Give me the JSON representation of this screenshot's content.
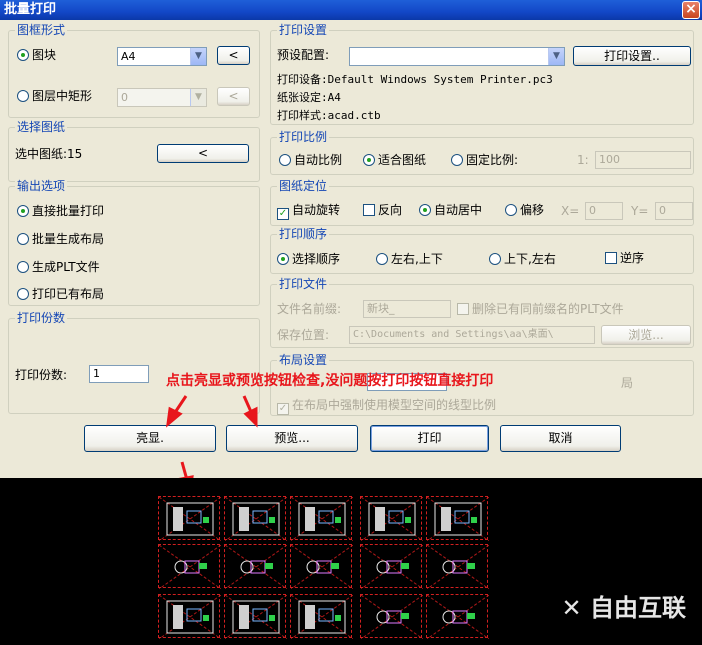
{
  "window": {
    "title": "批量打印",
    "close_glyph": "×"
  },
  "frame_form": {
    "title": "图框形式",
    "block_label": "图块",
    "block_value": "A4",
    "layer_rect_label": "图层中矩形",
    "layer_value": "0",
    "pick_glyph": "<"
  },
  "select_drawing": {
    "title": "选择图纸",
    "selected_label": "选中图纸:15",
    "pick_glyph": "<"
  },
  "output_options": {
    "title": "输出选项",
    "items": [
      "直接批量打印",
      "批量生成布局",
      "生成PLT文件",
      "打印已有布局"
    ],
    "selected": 0
  },
  "copies": {
    "title": "打印份数",
    "label": "打印份数:",
    "value": "1"
  },
  "print_settings": {
    "title": "打印设置",
    "preset_label": "预设配置:",
    "preset_value": "",
    "settings_button": "打印设置..",
    "device_line": "打印设备:Default Windows System Printer.pc3",
    "paper_line": "纸张设定:A4",
    "style_line": "打印样式:acad.ctb"
  },
  "scale": {
    "title": "打印比例",
    "options": [
      "自动比例",
      "适合图纸",
      "固定比例:"
    ],
    "selected": 1,
    "ratio_left": "1:",
    "ratio_value": "100"
  },
  "position": {
    "title": "图纸定位",
    "auto_rotate": "自动旋转",
    "reverse": "反向",
    "auto_center": "自动居中",
    "offset": "偏移",
    "x_label": "X=",
    "x_value": "0",
    "y_label": "Y=",
    "y_value": "0"
  },
  "order": {
    "title": "打印顺序",
    "options": [
      "选择顺序",
      "左右,上下",
      "上下,左右"
    ],
    "selected": 0,
    "reverse_label": "逆序"
  },
  "file": {
    "title": "打印文件",
    "prefix_label": "文件名前缀:",
    "prefix_value": "新块_",
    "delete_label": "删除已有同前缀名的PLT文件",
    "save_label": "保存位置:",
    "save_value": "C:\\Documents and Settings\\aa\\桌面\\",
    "browse_button": "浏览..."
  },
  "layout": {
    "title": "布局设置",
    "partial_hidden_suffix": "局",
    "model_linetype_label": "在布局中强制使用模型空间的线型比例"
  },
  "annotation": "点击亮显或预览按钮检查,没问题按打印按钮直接打印",
  "buttons": {
    "highlight": "亮显.",
    "preview": "预览...",
    "print": "打印",
    "cancel": "取消"
  },
  "watermark": "✕ 自由互联",
  "colors": {
    "title_blue": "#1547b5",
    "annotation_red": "#e8161c"
  }
}
